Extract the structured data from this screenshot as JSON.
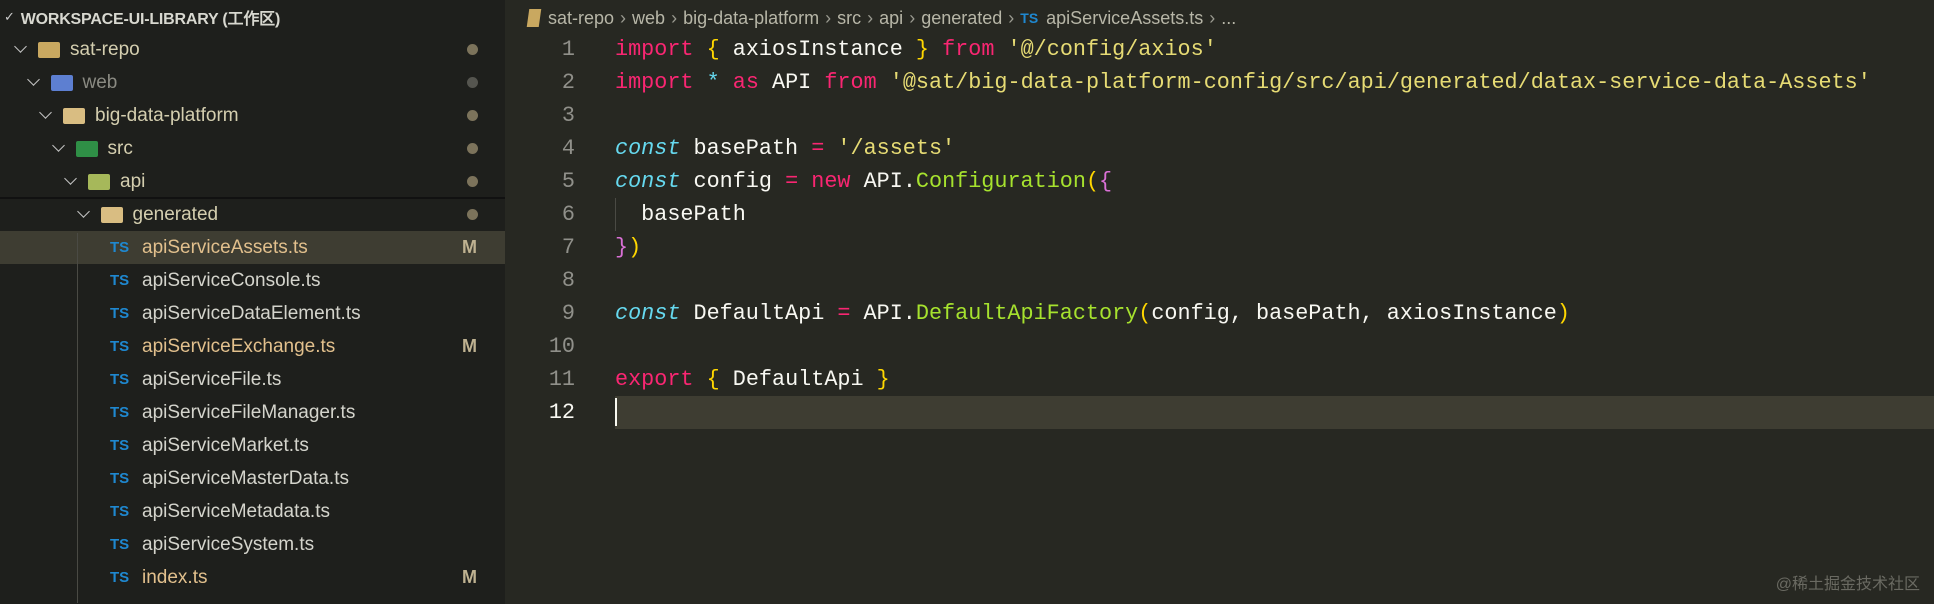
{
  "sidebar": {
    "header": "WORKSPACE-UI-LIBRARY (工作区)",
    "tree": [
      {
        "label": "sat-repo",
        "type": "folder",
        "depth": 0,
        "icon": "folder-git-icon",
        "icon_color": "#c9a860",
        "label_color": "#d4ceaf",
        "status": "dot"
      },
      {
        "label": "web",
        "type": "folder",
        "depth": 1,
        "icon": "folder-web-icon",
        "icon_color": "#5d7fd1",
        "label_color": "#8a8a82",
        "status": "dot-grey"
      },
      {
        "label": "big-data-platform",
        "type": "folder",
        "depth": 2,
        "icon": "folder-icon",
        "icon_color": "#d9bd82",
        "label_color": "#d4ceaf",
        "status": "dot"
      },
      {
        "label": "src",
        "type": "folder",
        "depth": 3,
        "icon": "folder-src-icon",
        "icon_color": "#2f8f46",
        "label_color": "#d4ceaf",
        "status": "dot"
      },
      {
        "label": "api",
        "type": "folder",
        "depth": 4,
        "icon": "folder-api-icon",
        "icon_color": "#a6b85a",
        "label_color": "#d4ceaf",
        "status": "dot"
      },
      {
        "label": "generated",
        "type": "folder",
        "depth": 5,
        "icon": "folder-icon",
        "icon_color": "#d9bd82",
        "label_color": "#d4ceaf",
        "status": "dot"
      },
      {
        "label": "apiServiceAssets.ts",
        "type": "file",
        "selected": true,
        "label_color": "#e2c08d",
        "status": "M"
      },
      {
        "label": "apiServiceConsole.ts",
        "type": "file",
        "label_color": "#d4d4cc"
      },
      {
        "label": "apiServiceDataElement.ts",
        "type": "file",
        "label_color": "#d4d4cc"
      },
      {
        "label": "apiServiceExchange.ts",
        "type": "file",
        "label_color": "#e2c08d",
        "status": "M"
      },
      {
        "label": "apiServiceFile.ts",
        "type": "file",
        "label_color": "#d4d4cc"
      },
      {
        "label": "apiServiceFileManager.ts",
        "type": "file",
        "label_color": "#d4d4cc"
      },
      {
        "label": "apiServiceMarket.ts",
        "type": "file",
        "label_color": "#d4d4cc"
      },
      {
        "label": "apiServiceMasterData.ts",
        "type": "file",
        "label_color": "#d4d4cc"
      },
      {
        "label": "apiServiceMetadata.ts",
        "type": "file",
        "label_color": "#d4d4cc"
      },
      {
        "label": "apiServiceSystem.ts",
        "type": "file",
        "label_color": "#d4d4cc"
      },
      {
        "label": "index.ts",
        "type": "file",
        "label_color": "#e2c08d",
        "status": "M"
      }
    ],
    "file_icon_text": "TS"
  },
  "breadcrumb": {
    "items": [
      "sat-repo",
      "web",
      "big-data-platform",
      "src",
      "api",
      "generated"
    ],
    "file_icon_text": "TS",
    "file": "apiServiceAssets.ts",
    "more": "..."
  },
  "colors": {
    "keyword": "#f92672",
    "string": "#e6db74",
    "storage": "#66d9ef",
    "func": "#a6e22e",
    "brace1": "#ffd700",
    "brace2": "#da70d6",
    "text": "#f8f8f2",
    "op": "#f92672",
    "star": "#66d9ef"
  },
  "editor": {
    "current_line": 12,
    "lines": [
      {
        "n": "1",
        "tokens": [
          [
            "keyword",
            "import"
          ],
          [
            "text",
            " "
          ],
          [
            "brace1",
            "{"
          ],
          [
            "text",
            " axiosInstance "
          ],
          [
            "brace1",
            "}"
          ],
          [
            "text",
            " "
          ],
          [
            "keyword",
            "from"
          ],
          [
            "text",
            " "
          ],
          [
            "string",
            "'@/config/axios'"
          ]
        ]
      },
      {
        "n": "2",
        "tokens": [
          [
            "keyword",
            "import"
          ],
          [
            "text",
            " "
          ],
          [
            "star",
            "*"
          ],
          [
            "text",
            " "
          ],
          [
            "keyword",
            "as"
          ],
          [
            "text",
            " API "
          ],
          [
            "keyword",
            "from"
          ],
          [
            "text",
            " "
          ],
          [
            "string",
            "'@sat/big-data-platform-config/src/api/generated/datax-service-data-Assets'"
          ]
        ]
      },
      {
        "n": "3",
        "tokens": []
      },
      {
        "n": "4",
        "tokens": [
          [
            "storage",
            "const"
          ],
          [
            "text",
            " basePath "
          ],
          [
            "op",
            "="
          ],
          [
            "text",
            " "
          ],
          [
            "string",
            "'/assets'"
          ]
        ]
      },
      {
        "n": "5",
        "tokens": [
          [
            "storage",
            "const"
          ],
          [
            "text",
            " config "
          ],
          [
            "op",
            "="
          ],
          [
            "text",
            " "
          ],
          [
            "keyword",
            "new"
          ],
          [
            "text",
            " API."
          ],
          [
            "func",
            "Configuration"
          ],
          [
            "brace1",
            "("
          ],
          [
            "brace2",
            "{"
          ]
        ]
      },
      {
        "n": "6",
        "tokens": [
          [
            "text",
            "  basePath"
          ]
        ]
      },
      {
        "n": "7",
        "tokens": [
          [
            "brace2",
            "}"
          ],
          [
            "brace1",
            ")"
          ]
        ]
      },
      {
        "n": "8",
        "tokens": []
      },
      {
        "n": "9",
        "tokens": [
          [
            "storage",
            "const"
          ],
          [
            "text",
            " DefaultApi "
          ],
          [
            "op",
            "="
          ],
          [
            "text",
            " API."
          ],
          [
            "func",
            "DefaultApiFactory"
          ],
          [
            "brace1",
            "("
          ],
          [
            "text",
            "config, basePath, axiosInstance"
          ],
          [
            "brace1",
            ")"
          ]
        ]
      },
      {
        "n": "10",
        "tokens": []
      },
      {
        "n": "11",
        "tokens": [
          [
            "keyword",
            "export"
          ],
          [
            "text",
            " "
          ],
          [
            "brace1",
            "{"
          ],
          [
            "text",
            " DefaultApi "
          ],
          [
            "brace1",
            "}"
          ]
        ]
      },
      {
        "n": "12",
        "tokens": []
      }
    ]
  },
  "watermark": "@稀土掘金技术社区"
}
